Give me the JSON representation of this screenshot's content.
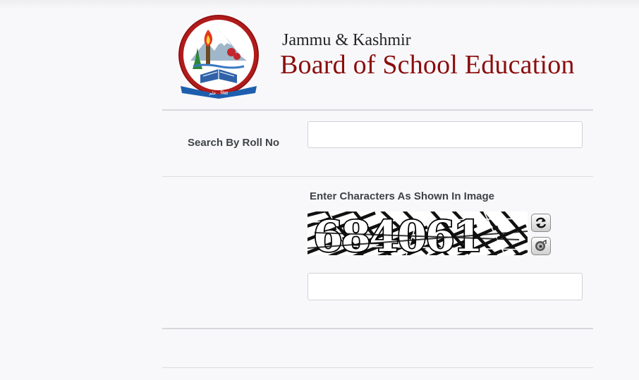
{
  "header": {
    "logo_ring_text": "Jammu & Kashmir Board Of School Education",
    "brand_line1": "Jammu & Kashmir",
    "brand_line2": "Board of School Education"
  },
  "search": {
    "label": "Search By Roll No",
    "value": "",
    "placeholder": ""
  },
  "captcha": {
    "label": "Enter Characters As Shown In Image",
    "image_text": "684061",
    "refresh_icon": "refresh-icon",
    "audio_icon": "audio-icon",
    "value": "",
    "placeholder": ""
  },
  "colors": {
    "brand_red": "#8b0d0d",
    "label_gray": "#3f4346",
    "page_bg": "#f8f8fa"
  }
}
